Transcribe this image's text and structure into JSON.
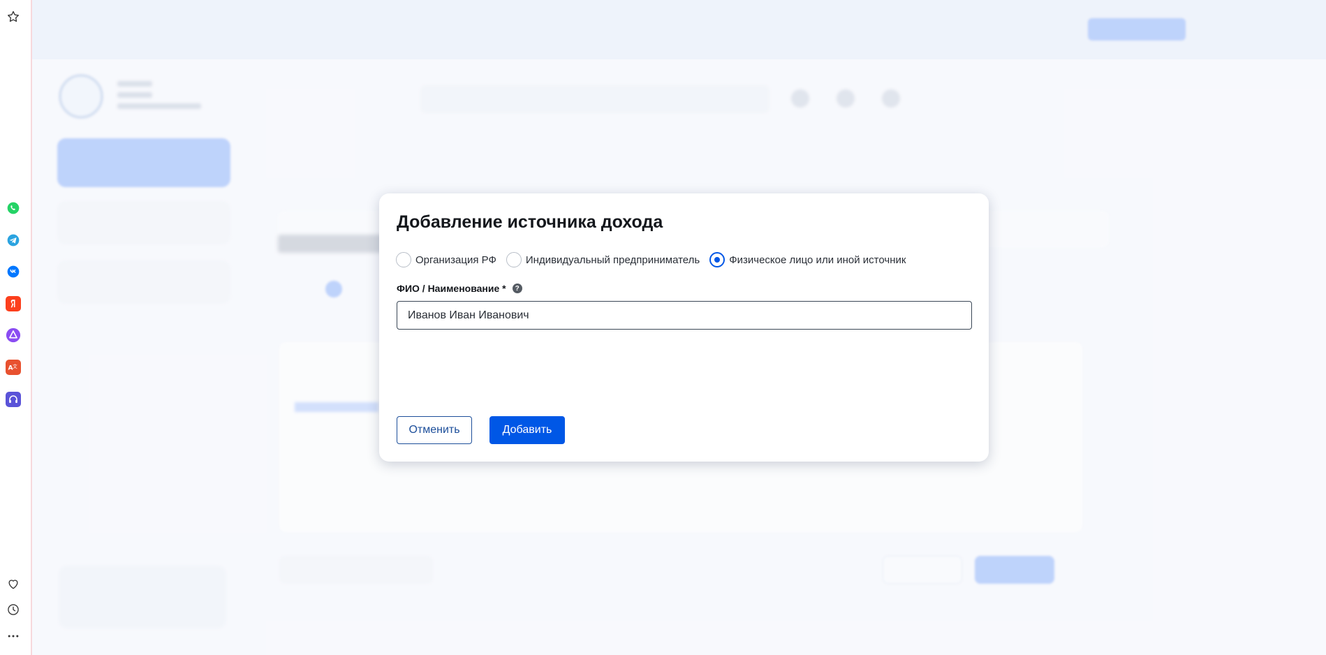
{
  "modal": {
    "title": "Добавление источника дохода",
    "radio_options": [
      {
        "label": "Организация РФ",
        "checked": false
      },
      {
        "label": "Индивидуальный предприниматель",
        "checked": false
      },
      {
        "label": "Физическое лицо или иной источник",
        "checked": true
      }
    ],
    "field_label": "ФИО / Наименование *",
    "help_icon_glyph": "?",
    "field_value": "Иванов Иван Иванович",
    "cancel_label": "Отменить",
    "add_label": "Добавить"
  },
  "colors": {
    "accent": "#0057e6",
    "cancel_border": "#1c4e9a"
  },
  "sidebar_icons": [
    "star-icon",
    "whatsapp-icon",
    "telegram-icon",
    "vk-icon",
    "yandex-icon",
    "alice-icon",
    "translate-icon",
    "headphones-icon",
    "heart-icon",
    "clock-icon",
    "more-icon"
  ]
}
